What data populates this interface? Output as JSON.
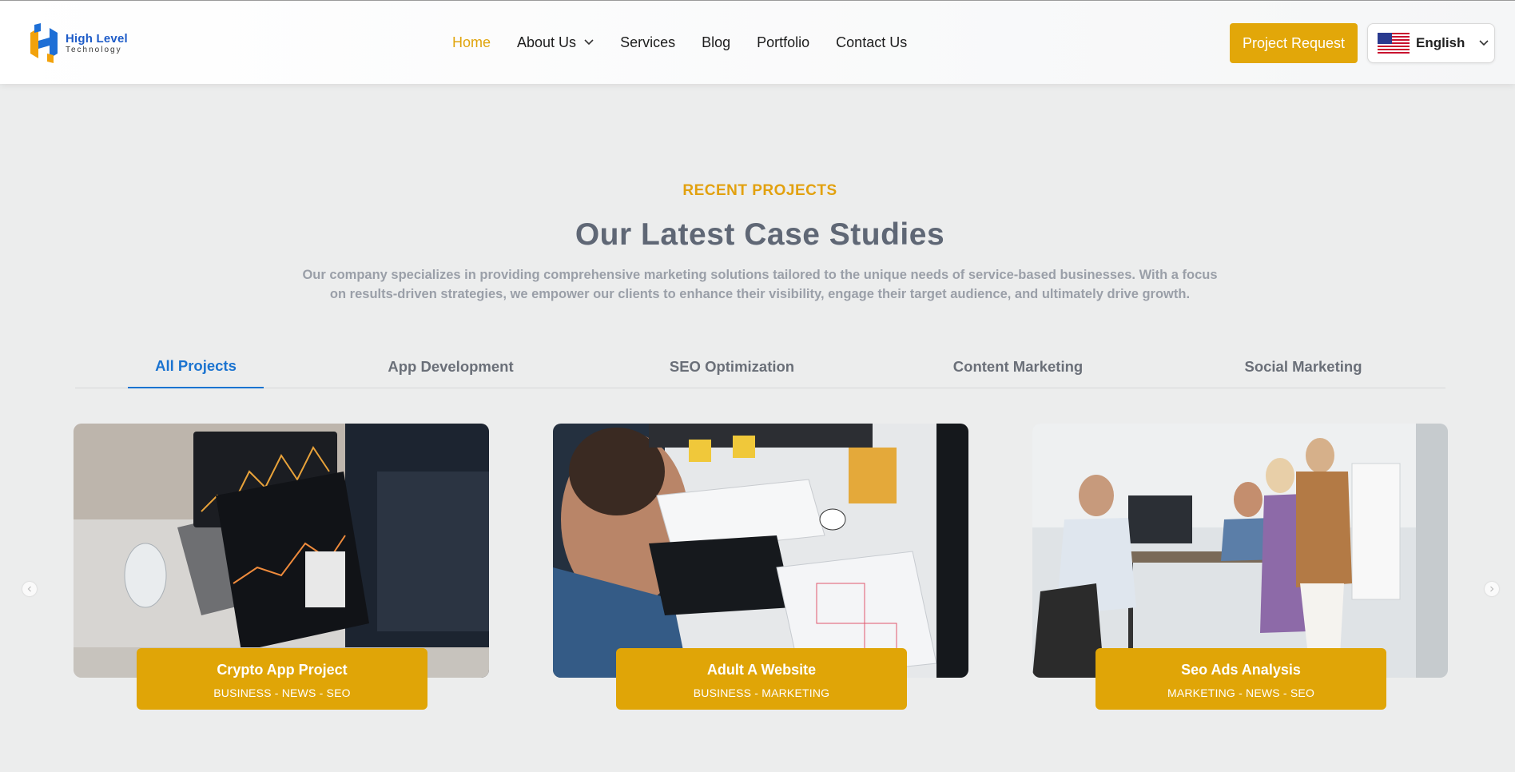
{
  "brand": {
    "name": "High Level",
    "tagline": "Technology"
  },
  "nav": {
    "items": [
      {
        "label": "Home",
        "active": true
      },
      {
        "label": "About Us",
        "has_dropdown": true
      },
      {
        "label": "Services"
      },
      {
        "label": "Blog"
      },
      {
        "label": "Portfolio"
      },
      {
        "label": "Contact Us"
      }
    ]
  },
  "header": {
    "cta_label": "Project Request",
    "language": {
      "label": "English",
      "flag": "us-flag-icon"
    }
  },
  "section": {
    "eyebrow": "RECENT PROJECTS",
    "title": "Our Latest Case Studies",
    "description": "Our company specializes in providing comprehensive marketing solutions tailored to the unique needs of service-based businesses. With a focus on results-driven strategies, we empower our clients to enhance their visibility, engage their target audience, and ultimately drive growth."
  },
  "tabs": [
    {
      "label": "All Projects",
      "active": true
    },
    {
      "label": "App Development"
    },
    {
      "label": "SEO Optimization"
    },
    {
      "label": "Content Marketing"
    },
    {
      "label": "Social Marketing"
    }
  ],
  "projects": [
    {
      "title": "Crypto App Project",
      "tags": "BUSINESS - NEWS - SEO"
    },
    {
      "title": "Adult A Website",
      "tags": "BUSINESS - MARKETING"
    },
    {
      "title": "Seo Ads Analysis",
      "tags": "MARKETING - NEWS - SEO"
    }
  ],
  "colors": {
    "accent": "#e2a709",
    "tab_active": "#1a73d0",
    "heading": "#5f6775",
    "background": "#eceded"
  }
}
